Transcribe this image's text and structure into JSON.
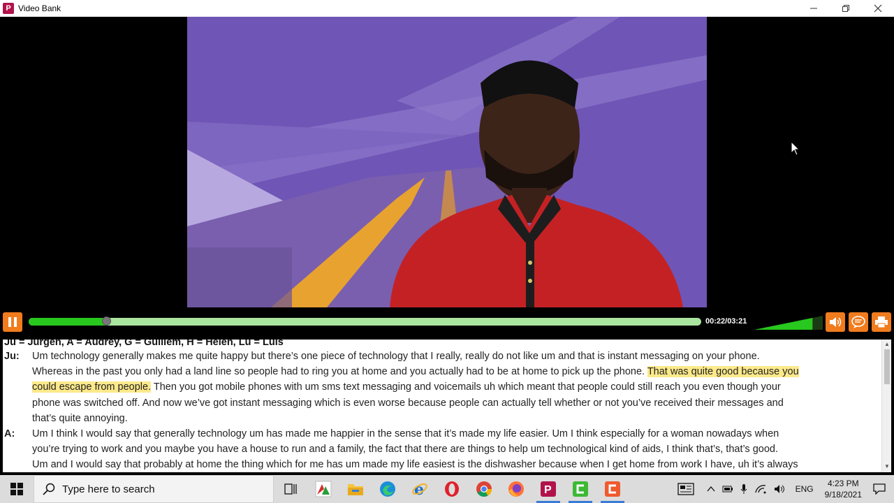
{
  "window": {
    "title": "Video Bank",
    "app_icon_letter": "P",
    "minimize_icon": "minimize-icon",
    "restore_icon": "restore-icon",
    "close_icon": "close-icon"
  },
  "player": {
    "time": "00:22/03:21",
    "progress": 0.115,
    "volume_level": 0.85,
    "accent_color": "#f07c1e",
    "progress_color": "#28c81e"
  },
  "transcript": {
    "legend": "Ju = Jürgen, A = Audrey, G = Guillem, H = Helen, Lu = Luis",
    "entries": [
      {
        "speaker": "Ju:",
        "lines": [
          {
            "segments": [
              {
                "text": "Um technology generally makes me quite happy but there’s one piece of technology that I really, really do not like um and that is instant messaging on your phone.",
                "hl": false
              }
            ]
          },
          {
            "segments": [
              {
                "text": "Whereas in the past you only had a land line so people had to ring you at home and you actually had to be at home to pick up the phone. ",
                "hl": false
              },
              {
                "text": "That was quite good because you",
                "hl": true
              }
            ]
          },
          {
            "segments": [
              {
                "text": "could escape from people.",
                "hl": true
              },
              {
                "text": " Then you got mobile phones with um sms text messaging and voicemails uh which meant that people could still reach you even though your",
                "hl": false
              }
            ]
          },
          {
            "segments": [
              {
                "text": "phone was switched off. And now we’ve got instant messaging which is even worse because people can actually tell whether or not you’ve received their messages and",
                "hl": false
              }
            ]
          },
          {
            "segments": [
              {
                "text": "that’s quite annoying.",
                "hl": false
              }
            ]
          }
        ]
      },
      {
        "speaker": "A:",
        "lines": [
          {
            "segments": [
              {
                "text": "Um I think I would say that generally technology um has made me happier in the sense that it’s made my life easier. Um I think especially for a woman nowadays when",
                "hl": false
              }
            ]
          },
          {
            "segments": [
              {
                "text": "you’re trying to work and you maybe you have a house to run and a family, the fact that there are things to help um technological kind of aids, I think that’s, that’s good.",
                "hl": false
              }
            ]
          },
          {
            "segments": [
              {
                "text": "Um and I would say that probably at home the thing which for me has um made my life easiest is the dishwasher because when I get home from work I have, uh it’s always",
                "hl": false
              }
            ]
          }
        ]
      }
    ]
  },
  "taskbar": {
    "search_placeholder": "Type here to search",
    "language": "ENG",
    "time": "4:23 PM",
    "date": "9/18/2021"
  }
}
